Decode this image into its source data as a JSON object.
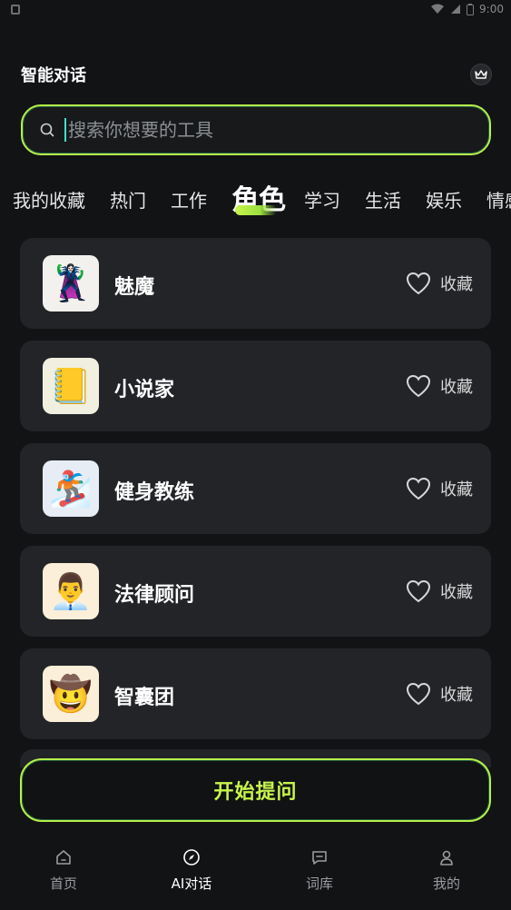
{
  "status_bar": {
    "time": "9:00"
  },
  "header": {
    "title": "智能对话",
    "crown_icon": "crown-icon"
  },
  "search": {
    "placeholder": "搜索你想要的工具",
    "value": ""
  },
  "tabs": [
    {
      "label": "我的收藏",
      "active": false
    },
    {
      "label": "热门",
      "active": false
    },
    {
      "label": "工作",
      "active": false
    },
    {
      "label": "角色",
      "active": true
    },
    {
      "label": "学习",
      "active": false
    },
    {
      "label": "生活",
      "active": false
    },
    {
      "label": "娱乐",
      "active": false
    },
    {
      "label": "情感",
      "active": false
    }
  ],
  "items": [
    {
      "name": "魅魔",
      "emoji": "🦹‍♀️",
      "bg": "#f3f1ee",
      "fav_label": "收藏"
    },
    {
      "name": "小说家",
      "emoji": "📒",
      "bg": "#f0efe0",
      "fav_label": "收藏"
    },
    {
      "name": "健身教练",
      "emoji": "🏂",
      "bg": "#e6edf5",
      "fav_label": "收藏"
    },
    {
      "name": "法律顾问",
      "emoji": "👨‍💼",
      "bg": "#fbefd9",
      "fav_label": "收藏"
    },
    {
      "name": "智囊团",
      "emoji": "🤠",
      "bg": "#fbefd9",
      "fav_label": "收藏"
    }
  ],
  "start_button": {
    "label": "开始提问"
  },
  "bottom_nav": [
    {
      "label": "首页",
      "icon": "home-icon",
      "active": false
    },
    {
      "label": "AI对话",
      "icon": "compass-icon",
      "active": true
    },
    {
      "label": "词库",
      "icon": "message-icon",
      "active": false
    },
    {
      "label": "我的",
      "icon": "user-icon",
      "active": false
    }
  ],
  "colors": {
    "accent": "#b6f04a",
    "background": "#121315",
    "card": "#222427"
  }
}
